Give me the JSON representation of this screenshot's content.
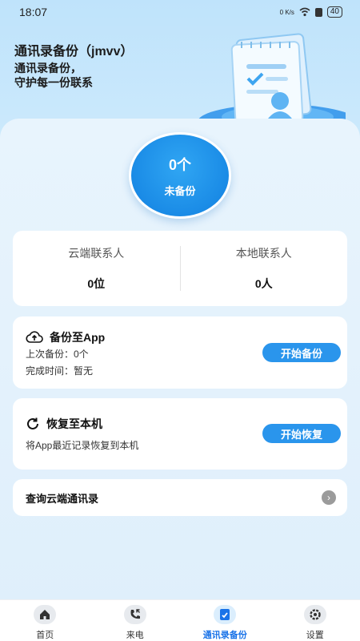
{
  "status_bar": {
    "time": "18:07",
    "network_speed": "0 K/s",
    "battery": "40"
  },
  "header": {
    "title": "通讯录备份（jmvv）",
    "subtitle_line1": "通讯录备份，",
    "subtitle_line2": "守护每一份联系"
  },
  "backup_status": {
    "count": "0个",
    "label": "未备份"
  },
  "stats": {
    "cloud_label": "云端联系人",
    "cloud_value": "0位",
    "local_label": "本地联系人",
    "local_value": "0人"
  },
  "backup_card": {
    "title": "备份至App",
    "last_backup": "上次备份：0个",
    "finish_time": "完成时间：暂无",
    "button": "开始备份"
  },
  "restore_card": {
    "title": "恢复至本机",
    "description": "将App最近记录恢复到本机",
    "button": "开始恢复"
  },
  "query_card": {
    "label": "查询云端通讯录"
  },
  "bottom_nav": {
    "items": [
      {
        "label": "首页",
        "icon": "home-icon"
      },
      {
        "label": "来电",
        "icon": "incoming-call-icon"
      },
      {
        "label": "通讯录备份",
        "icon": "contacts-backup-icon",
        "active": true
      },
      {
        "label": "设置",
        "icon": "settings-icon"
      }
    ]
  },
  "colors": {
    "accent": "#2a95ec",
    "active_nav": "#1a73e8",
    "circle": "#1a8be6"
  }
}
